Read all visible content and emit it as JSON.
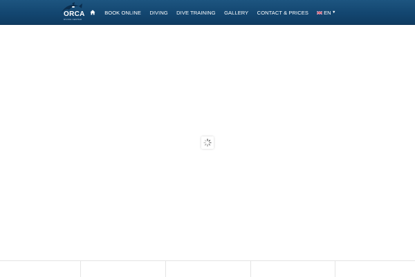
{
  "header": {
    "logo": {
      "brand": "ORCA",
      "tagline": "DIVING CENTER"
    },
    "nav": {
      "home_icon": "home-icon",
      "items": [
        {
          "label": "BOOK ONLINE"
        },
        {
          "label": "DIVING"
        },
        {
          "label": "DIVE TRAINING"
        },
        {
          "label": "GALLERY"
        },
        {
          "label": "CONTACT & PRICES"
        }
      ],
      "language": {
        "flag_icon": "uk-flag-icon",
        "label": "EN",
        "caret_icon": "caret-down-icon"
      }
    }
  },
  "loader": {
    "icon": "spinner-icon"
  },
  "colors": {
    "header": "#134670",
    "header_light": "#1d5580",
    "text": "#ffffff",
    "background": "#ffffff",
    "divider": "#e4e4e4"
  }
}
